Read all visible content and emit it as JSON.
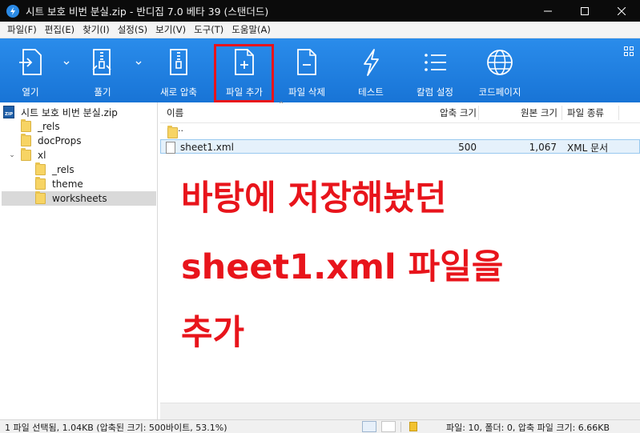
{
  "window": {
    "title": "시트 보호 비번 분실.zip - 반디집 7.0 베타 39 (스탠더드)"
  },
  "menu": [
    "파일(F)",
    "편집(E)",
    "찾기(I)",
    "설정(S)",
    "보기(V)",
    "도구(T)",
    "도움말(A)"
  ],
  "toolbar": {
    "open": "열기",
    "extract": "풀기",
    "new_archive": "새로 압축",
    "add_file": "파일 추가",
    "delete_file": "파일 삭제",
    "test": "테스트",
    "column_settings": "칼럼 설정",
    "codepage": "코드페이지",
    "highlighted_button": "파일 추가",
    "highlight_color": "#e8141b",
    "accent_color": "#1d7fe0"
  },
  "tree": {
    "root": "시트 보호 비번 분실.zip",
    "items": [
      {
        "label": "_rels"
      },
      {
        "label": "docProps"
      },
      {
        "label": "xl"
      },
      {
        "label": "_rels"
      },
      {
        "label": "theme"
      },
      {
        "label": "worksheets"
      }
    ],
    "selected": "worksheets"
  },
  "list": {
    "columns": {
      "name": "이름",
      "compressed": "압축 크기",
      "original": "원본 크기",
      "type": "파일 종류"
    },
    "rows": [
      {
        "name": "..",
        "compressed": "",
        "original": "",
        "type": ""
      },
      {
        "name": "sheet1.xml",
        "compressed": "500",
        "original": "1,067",
        "type": "XML 문서"
      }
    ]
  },
  "caption": {
    "line1": "바탕에 저장해놨던",
    "line2": "sheet1.xml 파일을",
    "line3": "추가",
    "color": "#e8141b"
  },
  "status": {
    "left": "1 파일 선택됨, 1.04KB (압축된 크기: 500바이트, 53.1%)",
    "right": "파일: 10, 폴더: 0, 압축 파일 크기: 6.66KB"
  }
}
